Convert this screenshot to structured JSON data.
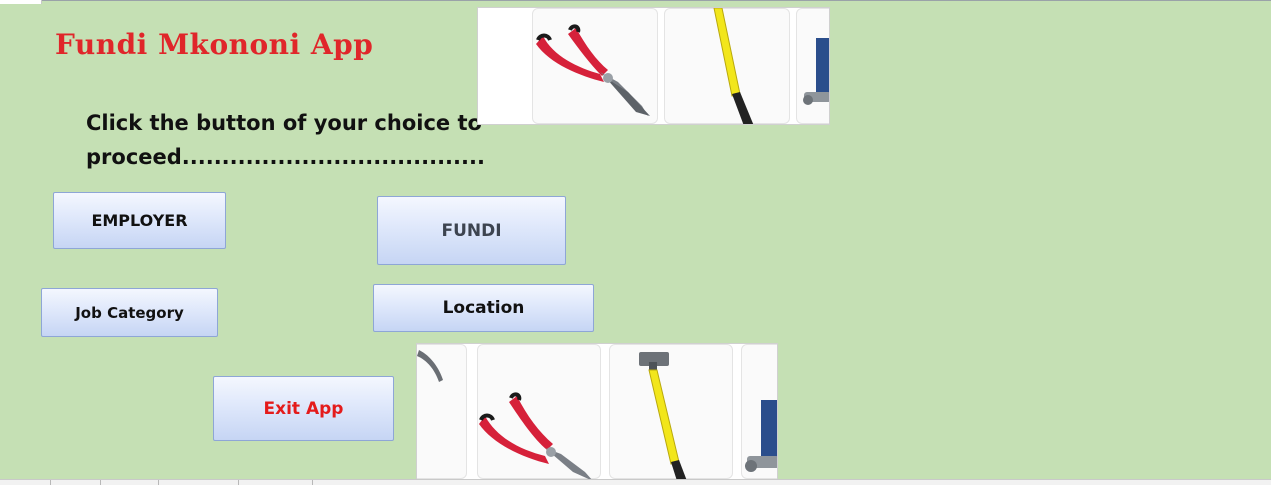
{
  "app": {
    "title": "Fundi Mkononi App",
    "instruction_line1": "Click the button of your  choice to",
    "instruction_line2": "proceed......................................"
  },
  "buttons": {
    "employer": "EMPLOYER",
    "fundi": "FUNDI",
    "job_category": "Job Category",
    "location": "Location",
    "exit_app": "Exit App"
  },
  "colors": {
    "background": "#c5e0b4",
    "title": "#e0262a",
    "exit_text": "#e41b1b",
    "fundi_text": "#3d4450",
    "button_border": "#8ea6d6",
    "plier_handle": "#d6213a",
    "hammer_handle": "#f2e61b",
    "vise": "#2b4e8c"
  },
  "images": {
    "top": [
      "plier-icon",
      "hammer-handle-icon",
      "vise-icon"
    ],
    "bottom": [
      "hook-icon",
      "plier-icon",
      "hammer-icon",
      "vise-icon"
    ]
  }
}
